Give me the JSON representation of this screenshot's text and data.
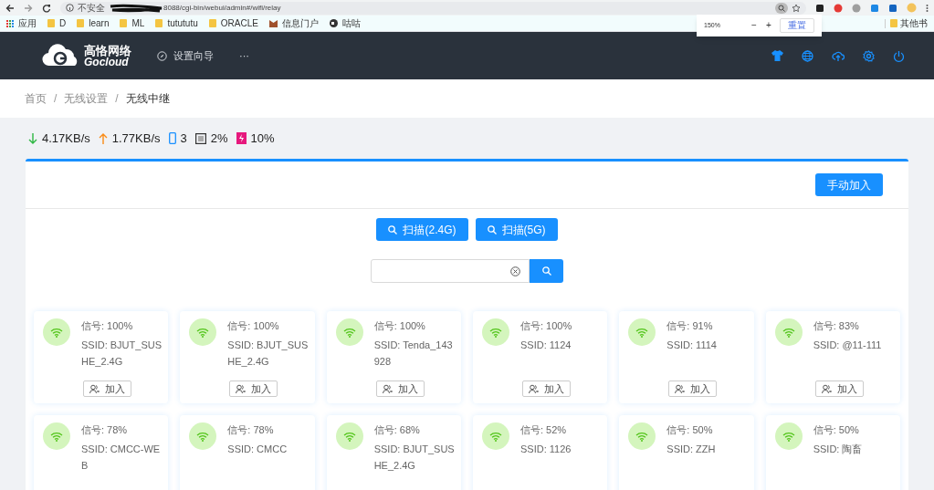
{
  "browser": {
    "security": "不安全",
    "url": "8088/cgi-bin/webui/admin#/wifi/relay",
    "bookmarks": [
      {
        "label": "应用",
        "kind": "apps"
      },
      {
        "label": "D",
        "kind": "folder"
      },
      {
        "label": "learn",
        "kind": "folder"
      },
      {
        "label": "ML",
        "kind": "folder"
      },
      {
        "label": "tutututu",
        "kind": "folder"
      },
      {
        "label": "ORACLE",
        "kind": "folder"
      },
      {
        "label": "信息门户",
        "kind": "site"
      },
      {
        "label": "咕咕",
        "kind": "globe"
      }
    ],
    "other_bookmarks": "其他书",
    "zoom_popup": {
      "value": "150%",
      "minus": "−",
      "plus": "+",
      "reset": "重置"
    }
  },
  "header": {
    "brand": "高恪网络",
    "brand_en": "Gocloud",
    "nav": [
      {
        "label": "设置向导",
        "kind": "compass"
      },
      {
        "label": "···",
        "kind": "more"
      }
    ]
  },
  "breadcrumb": {
    "separator": "/",
    "items": [
      "首页",
      "无线设置",
      "无线中继"
    ]
  },
  "stats": [
    {
      "kind": "down",
      "value": "4.17KB/s"
    },
    {
      "kind": "up",
      "value": "1.77KB/s"
    },
    {
      "kind": "devices",
      "value": "3"
    },
    {
      "kind": "cpu",
      "value": "2%"
    },
    {
      "kind": "memory",
      "value": "10%"
    }
  ],
  "manual_button": "手动加入",
  "scan_buttons": [
    "扫描(2.4G)",
    "扫描(5G)"
  ],
  "networks": [
    {
      "signal": "信号: 100%",
      "ssid": "SSID: BJUT_SUSHE_2.4G",
      "join": "加入"
    },
    {
      "signal": "信号: 100%",
      "ssid": "SSID: BJUT_SUSHE_2.4G",
      "join": "加入"
    },
    {
      "signal": "信号: 100%",
      "ssid": "SSID: Tenda_143928",
      "join": "加入"
    },
    {
      "signal": "信号: 100%",
      "ssid": "SSID: 1124",
      "join": "加入"
    },
    {
      "signal": "信号: 91%",
      "ssid": "SSID: 1114",
      "join": "加入"
    },
    {
      "signal": "信号: 83%",
      "ssid": "SSID: @11-111",
      "join": "加入"
    },
    {
      "signal": "信号: 78%",
      "ssid": "SSID: CMCC-WEB"
    },
    {
      "signal": "信号: 78%",
      "ssid": "SSID: CMCC"
    },
    {
      "signal": "信号: 68%",
      "ssid": "SSID: BJUT_SUSHE_2.4G"
    },
    {
      "signal": "信号: 52%",
      "ssid": "SSID: 1126"
    },
    {
      "signal": "信号: 50%",
      "ssid": "SSID: ZZH"
    },
    {
      "signal": "信号: 50%",
      "ssid": "SSID: 陶畜"
    }
  ]
}
